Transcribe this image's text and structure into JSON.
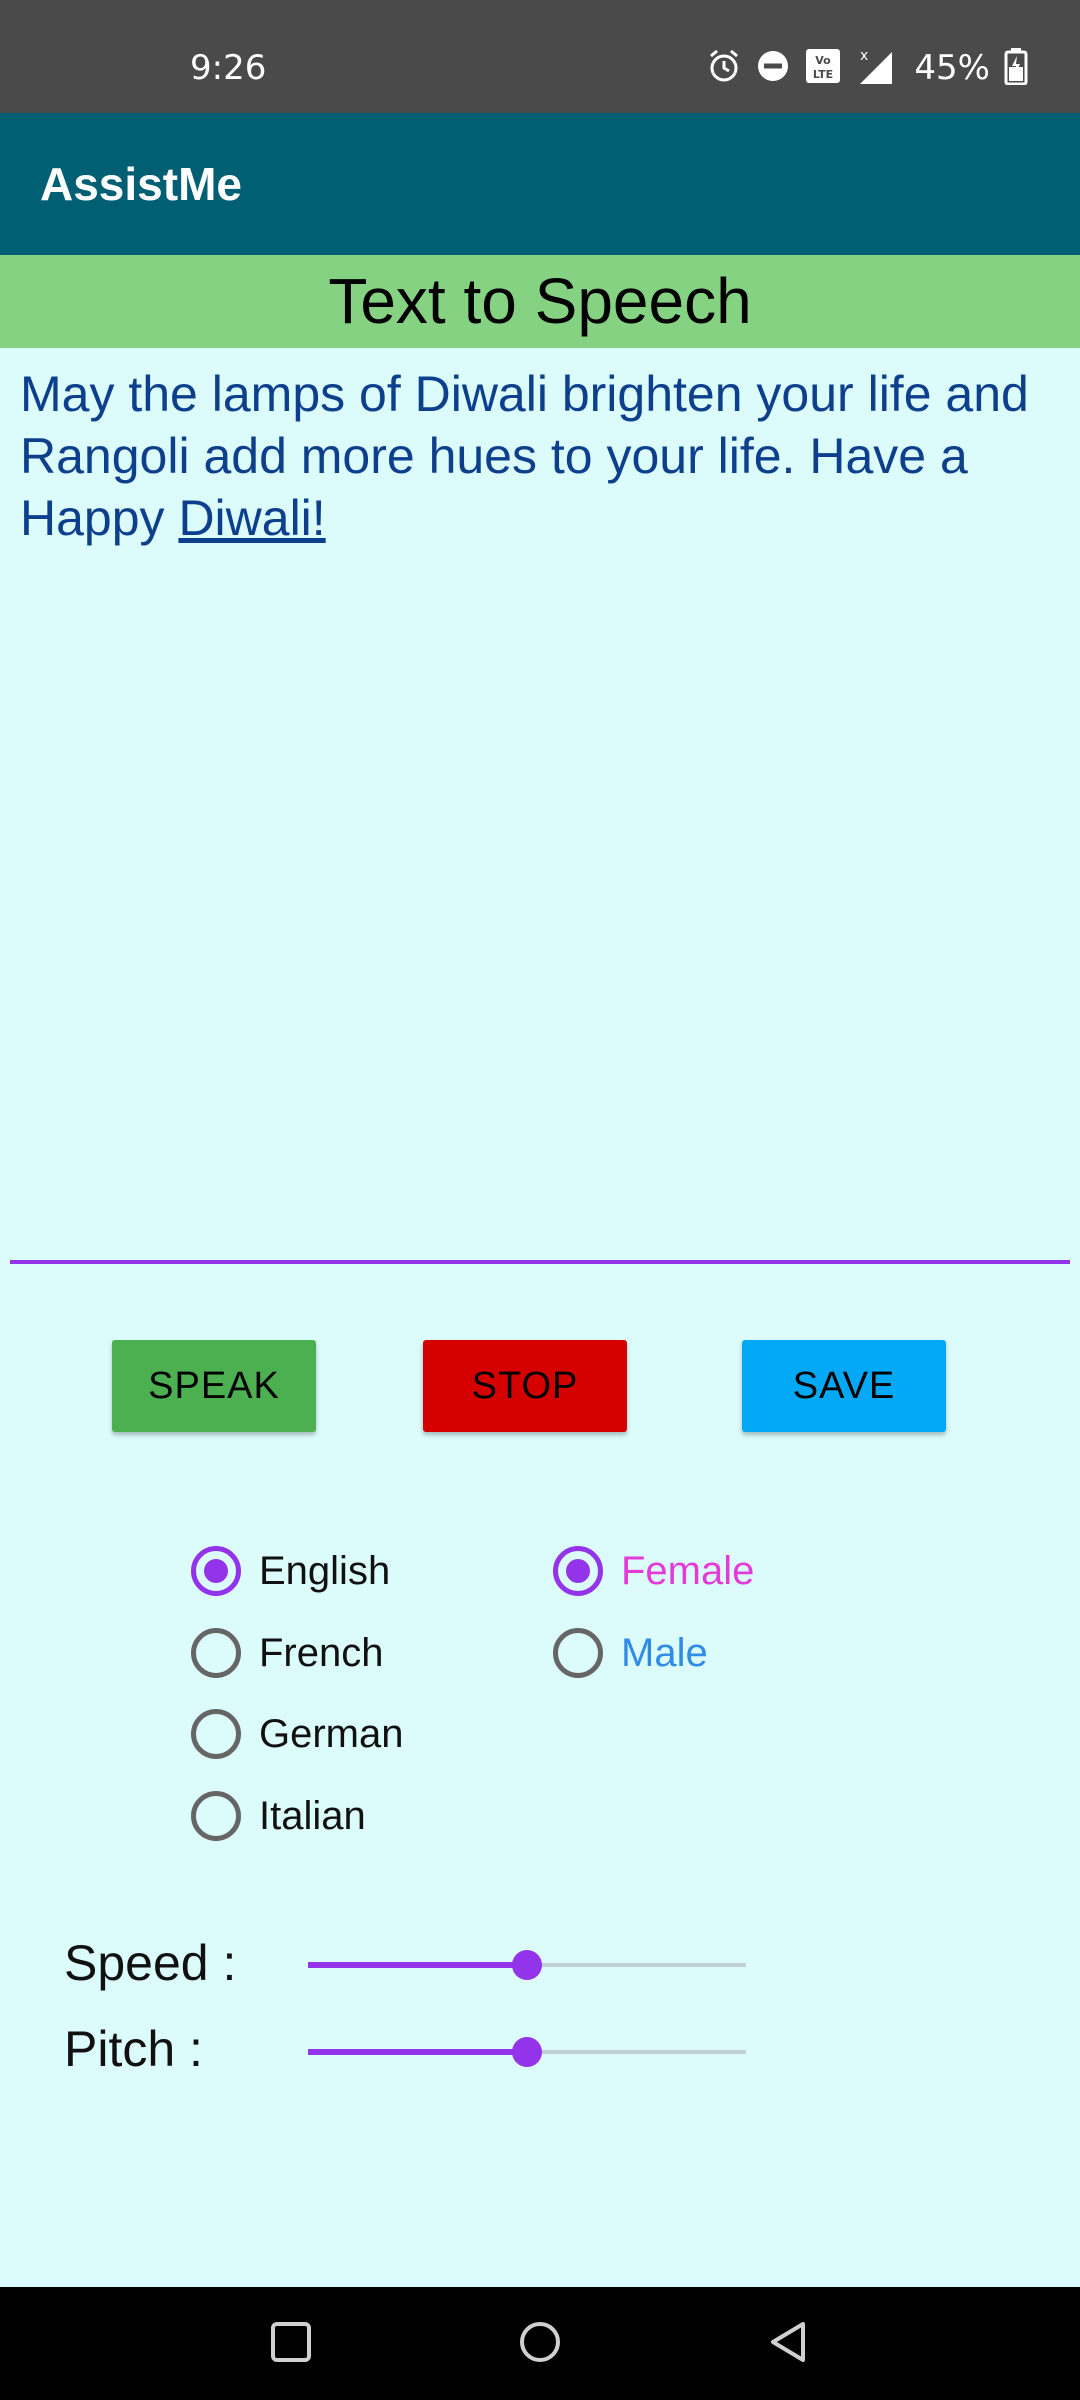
{
  "status_bar": {
    "time": "9:26",
    "battery": "45%",
    "icons": [
      "alarm-icon",
      "do-not-disturb-icon",
      "volte-icon",
      "signal-icon",
      "battery-icon"
    ]
  },
  "app_bar": {
    "title": "AssistMe"
  },
  "section": {
    "title": "Text to Speech"
  },
  "editor": {
    "text_part1": "May the lamps of Diwali brighten your life and Rangoli add more hues to your life. Have a Happy ",
    "text_link": "Diwali!"
  },
  "buttons": {
    "speak": "SPEAK",
    "stop": "STOP",
    "save": "SAVE"
  },
  "languages": {
    "options": [
      "English",
      "French",
      "German",
      "Italian"
    ],
    "selected": "English"
  },
  "voices": {
    "options": [
      "Female",
      "Male"
    ],
    "selected": "Female",
    "colors": {
      "female": "#e23bd8",
      "male": "#2f8be6"
    }
  },
  "sliders": {
    "speed": {
      "label": "Speed :",
      "value": 0.5
    },
    "pitch": {
      "label": "Pitch :",
      "value": 0.5
    }
  },
  "nav_bar": {
    "icons": [
      "recents-icon",
      "home-icon",
      "back-icon"
    ]
  },
  "colors": {
    "app_bar": "#005f73",
    "header": "#86d283",
    "background": "#dcfcfc",
    "accent": "#9333ea",
    "speak": "#4caf50",
    "stop": "#d50000",
    "save": "#03a9f4"
  }
}
